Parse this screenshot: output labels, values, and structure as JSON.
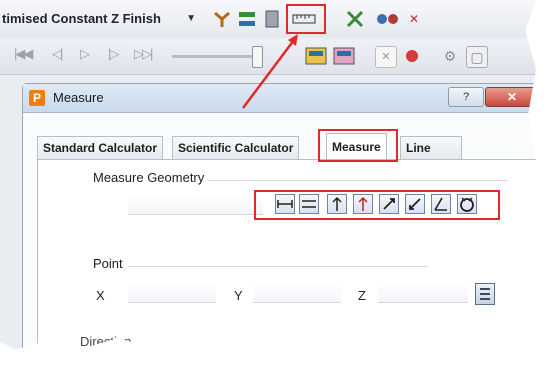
{
  "toolbar": {
    "operation_combo_value": "timised Constant Z Finish",
    "icons": [
      "tool-icon",
      "pattern-icon",
      "stock-icon",
      "measure-ruler-icon",
      "crossover-icon",
      "toolpath-icon",
      "close-icon"
    ],
    "playback_icons": [
      "skip-start-icon",
      "step-back-icon",
      "play-icon",
      "step-forward-icon",
      "skip-end-icon"
    ]
  },
  "dialog": {
    "title": "Measure",
    "logo_letter": "P",
    "help_label": "?",
    "close_label": "✕",
    "tabs": [
      {
        "label": "Standard Calculator",
        "active": false
      },
      {
        "label": "Scientific Calculator",
        "active": false
      },
      {
        "label": "Measure",
        "active": true
      },
      {
        "label": "Line",
        "active": false
      }
    ],
    "measure_geometry_label": "Measure Geometry",
    "geometry_buttons": [
      "line-distance-icon",
      "double-line-icon",
      "arc-icon",
      "arc-variant-icon",
      "diameter-icon",
      "diameter-variant-icon",
      "angle-icon",
      "circle-3pt-icon"
    ],
    "point_label": "Point",
    "x_label": "X",
    "y_label": "Y",
    "z_label": "Z",
    "direction_label": "Direction"
  },
  "colors": {
    "highlight": "#e02a2a",
    "dialog_title_bg": "#c9d9ee",
    "accent_orange": "#ef7d10"
  }
}
